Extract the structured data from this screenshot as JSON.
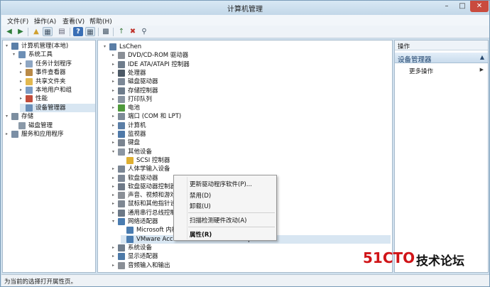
{
  "window": {
    "title": "计算机管理"
  },
  "menubar": [
    "文件(F)",
    "操作(A)",
    "查看(V)",
    "帮助(H)"
  ],
  "left_tree": [
    {
      "label": "计算机管理(本地)",
      "level": 0,
      "arrow": "▾",
      "icon": "computer-management-icon",
      "color": "#5a7fa8"
    },
    {
      "label": "系统工具",
      "level": 1,
      "arrow": "▾",
      "icon": "system-tools-icon",
      "color": "#6d8fb5"
    },
    {
      "label": "任务计划程序",
      "level": 2,
      "arrow": "▸",
      "icon": "task-scheduler-icon",
      "color": "#8ea6c2"
    },
    {
      "label": "事件查看器",
      "level": 2,
      "arrow": "▸",
      "icon": "event-viewer-icon",
      "color": "#b98a47"
    },
    {
      "label": "共享文件夹",
      "level": 2,
      "arrow": "▸",
      "icon": "shared-folder-icon",
      "color": "#e2b850"
    },
    {
      "label": "本地用户和组",
      "level": 2,
      "arrow": "▸",
      "icon": "users-group-icon",
      "color": "#7a9bc4"
    },
    {
      "label": "性能",
      "level": 2,
      "arrow": "▸",
      "icon": "performance-icon",
      "color": "#c24d3c"
    },
    {
      "label": "设备管理器",
      "level": 2,
      "arrow": "",
      "icon": "device-manager-icon",
      "color": "#6a8fb8",
      "selected": true
    },
    {
      "label": "存储",
      "level": 0,
      "arrow": "▾",
      "icon": "storage-icon",
      "color": "#7c8ea0"
    },
    {
      "label": "磁盘管理",
      "level": 1,
      "arrow": "",
      "icon": "disk-management-icon",
      "color": "#8a99a8"
    },
    {
      "label": "服务和应用程序",
      "level": 0,
      "arrow": "▸",
      "icon": "services-icon",
      "color": "#7b8fa5"
    }
  ],
  "device_tree": [
    {
      "label": "LsChen",
      "level": 0,
      "arrow": "▾",
      "icon": "computer-icon",
      "color": "#5b7ea6"
    },
    {
      "label": "DVD/CD-ROM 驱动器",
      "level": 1,
      "arrow": "▸",
      "icon": "dvd-drive-icon",
      "color": "#8a8f96"
    },
    {
      "label": "IDE ATA/ATAPI 控制器",
      "level": 1,
      "arrow": "▸",
      "icon": "ide-controller-icon",
      "color": "#6f7d8c"
    },
    {
      "label": "处理器",
      "level": 1,
      "arrow": "▸",
      "icon": "processor-icon",
      "color": "#4c5966"
    },
    {
      "label": "磁盘驱动器",
      "level": 1,
      "arrow": "▸",
      "icon": "disk-drive-icon",
      "color": "#7c8896"
    },
    {
      "label": "存储控制器",
      "level": 1,
      "arrow": "▸",
      "icon": "storage-controller-icon",
      "color": "#6e7c8b"
    },
    {
      "label": "打印队列",
      "level": 1,
      "arrow": "▸",
      "icon": "printer-icon",
      "color": "#8a95a2"
    },
    {
      "label": "电池",
      "level": 1,
      "arrow": "▸",
      "icon": "battery-icon",
      "color": "#4f9a3c"
    },
    {
      "label": "端口 (COM 和 LPT)",
      "level": 1,
      "arrow": "▸",
      "icon": "port-icon",
      "color": "#7e8b98"
    },
    {
      "label": "计算机",
      "level": 1,
      "arrow": "▸",
      "icon": "computer-icon",
      "color": "#5b7ea6"
    },
    {
      "label": "监视器",
      "level": 1,
      "arrow": "▸",
      "icon": "monitor-icon",
      "color": "#4f79a8"
    },
    {
      "label": "键盘",
      "level": 1,
      "arrow": "▸",
      "icon": "keyboard-icon",
      "color": "#7a8490"
    },
    {
      "label": "其他设备",
      "level": 1,
      "arrow": "▾",
      "icon": "other-devices-icon",
      "color": "#8c96a2"
    },
    {
      "label": "SCSI 控制器",
      "level": 2,
      "arrow": "",
      "icon": "warning-device-icon",
      "color": "#e0b030"
    },
    {
      "label": "人体学输入设备",
      "level": 1,
      "arrow": "▸",
      "icon": "hid-icon",
      "color": "#7a8694"
    },
    {
      "label": "软盘驱动器",
      "level": 1,
      "arrow": "▸",
      "icon": "floppy-drive-icon",
      "color": "#7d8795"
    },
    {
      "label": "软盘驱动器控制器",
      "level": 1,
      "arrow": "▸",
      "icon": "floppy-controller-icon",
      "color": "#6f7a88"
    },
    {
      "label": "声音、视频和游戏控制器",
      "level": 1,
      "arrow": "▸",
      "icon": "sound-icon",
      "color": "#8a8f96"
    },
    {
      "label": "鼠标和其他指针设备",
      "level": 1,
      "arrow": "▸",
      "icon": "mouse-icon",
      "color": "#7f8893"
    },
    {
      "label": "通用串行总线控制器",
      "level": 1,
      "arrow": "▸",
      "icon": "usb-icon",
      "color": "#6c7886"
    },
    {
      "label": "网络适配器",
      "level": 1,
      "arrow": "▾",
      "icon": "network-adapter-icon",
      "color": "#4a7cb0"
    },
    {
      "label": "Microsoft 内核调试网络适配器",
      "level": 2,
      "arrow": "",
      "icon": "network-adapter-icon",
      "color": "#4a7cb0"
    },
    {
      "label": "VMware Accelerated AMD PCNet Adapter",
      "level": 2,
      "arrow": "",
      "icon": "network-adapter-icon",
      "color": "#4a7cb0",
      "selected": true
    },
    {
      "label": "系统设备",
      "level": 1,
      "arrow": "▸",
      "icon": "system-device-icon",
      "color": "#6f7d8c"
    },
    {
      "label": "显示适配器",
      "level": 1,
      "arrow": "▸",
      "icon": "display-adapter-icon",
      "color": "#4d7aa8"
    },
    {
      "label": "音频输入和输出",
      "level": 1,
      "arrow": "▸",
      "icon": "audio-io-icon",
      "color": "#8a8f96"
    }
  ],
  "context_menu": [
    {
      "label": "更新驱动程序软件(P)...",
      "bold": false
    },
    {
      "label": "禁用(D)",
      "bold": false
    },
    {
      "label": "卸载(U)",
      "bold": false
    },
    {
      "label": "扫描检测硬件改动(A)",
      "bold": false
    },
    {
      "label": "属性(R)",
      "bold": true
    }
  ],
  "actions_pane": {
    "header": "操作",
    "section": "设备管理器",
    "more": "更多操作"
  },
  "statusbar": {
    "text": "为当前的选择打开属性页。"
  },
  "watermark": {
    "part1": "51CTO",
    "part2": "技术论坛"
  }
}
